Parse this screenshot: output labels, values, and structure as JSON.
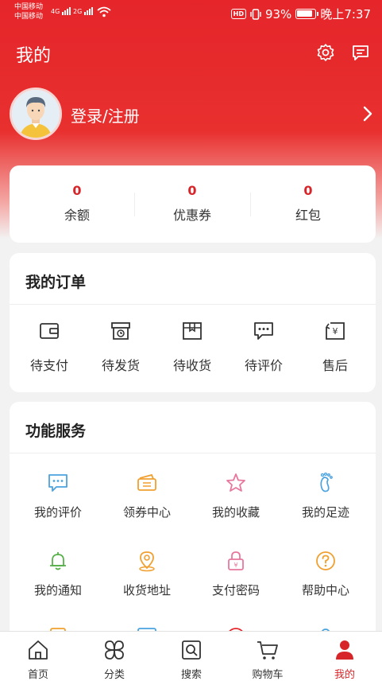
{
  "status_bar": {
    "carrier_1": "中国移动",
    "carrier_2": "中国移动",
    "net_1": "4G",
    "net_2": "2G",
    "hd": "HD",
    "battery": "93%",
    "time": "晚上7:37"
  },
  "header": {
    "title": "我的"
  },
  "profile": {
    "login_text": "登录/注册"
  },
  "balance": [
    {
      "value": "0",
      "label": "余额"
    },
    {
      "value": "0",
      "label": "优惠券"
    },
    {
      "value": "0",
      "label": "红包"
    }
  ],
  "orders": {
    "title": "我的订单",
    "items": [
      {
        "label": "待支付",
        "icon": "wallet-icon"
      },
      {
        "label": "待发货",
        "icon": "box-clock-icon"
      },
      {
        "label": "待收货",
        "icon": "package-icon"
      },
      {
        "label": "待评价",
        "icon": "chat-dots-icon"
      },
      {
        "label": "售后",
        "icon": "yen-return-icon"
      }
    ]
  },
  "services": {
    "title": "功能服务",
    "items": [
      {
        "label": "我的评价",
        "icon": "chat-icon",
        "color": "#4aa3df"
      },
      {
        "label": "领券中心",
        "icon": "coupon-icon",
        "color": "#f0a030"
      },
      {
        "label": "我的收藏",
        "icon": "star-icon",
        "color": "#e8779e"
      },
      {
        "label": "我的足迹",
        "icon": "footprint-icon",
        "color": "#4aa3df"
      },
      {
        "label": "我的通知",
        "icon": "bell-icon",
        "color": "#57b04a"
      },
      {
        "label": "收货地址",
        "icon": "location-icon",
        "color": "#f0a030"
      },
      {
        "label": "支付密码",
        "icon": "lock-icon",
        "color": "#e8779e"
      },
      {
        "label": "帮助中心",
        "icon": "help-icon",
        "color": "#f0a030"
      }
    ]
  },
  "nav": [
    {
      "label": "首页",
      "icon": "home-icon"
    },
    {
      "label": "分类",
      "icon": "category-icon"
    },
    {
      "label": "搜索",
      "icon": "search-icon"
    },
    {
      "label": "购物车",
      "icon": "cart-icon"
    },
    {
      "label": "我的",
      "icon": "user-icon",
      "active": true
    }
  ],
  "colors": {
    "brand_red": "#e5252a",
    "accent_red": "#d7262a"
  }
}
